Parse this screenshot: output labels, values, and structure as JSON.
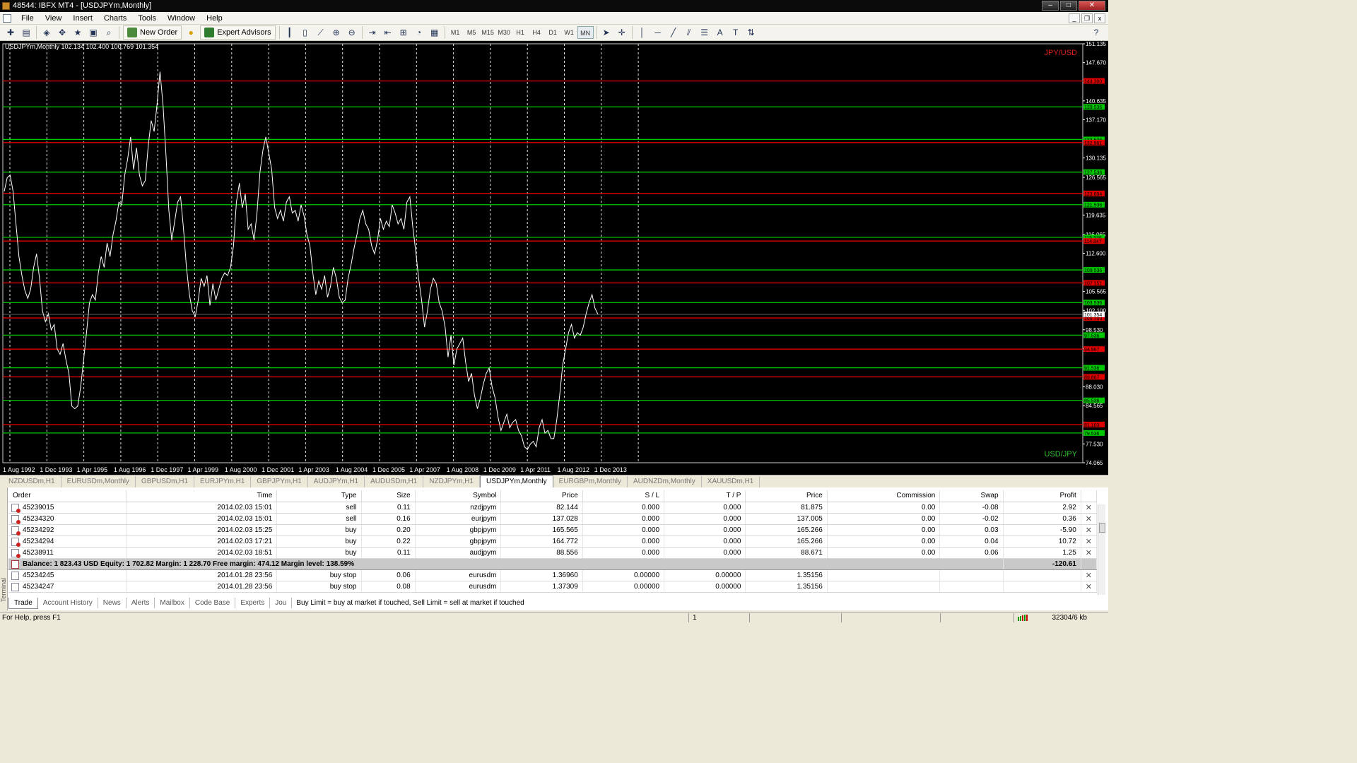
{
  "window": {
    "title": "48544: IBFX MT4 - [USDJPYm,Monthly]"
  },
  "menu": [
    "File",
    "View",
    "Insert",
    "Charts",
    "Tools",
    "Window",
    "Help"
  ],
  "toolbar": {
    "new_order_label": "New Order",
    "expert_advisors_label": "Expert Advisors",
    "timeframes": [
      "M1",
      "M5",
      "M15",
      "M30",
      "H1",
      "H4",
      "D1",
      "W1",
      "MN"
    ],
    "active_timeframe": "MN",
    "icons": [
      "new-chart-icon",
      "profiles-icon",
      "market-watch-icon",
      "navigator-icon",
      "favorites-icon",
      "terminal-icon",
      "tester-icon",
      "bar-chart-icon",
      "candlestick-icon",
      "line-chart-icon",
      "zoom-in-icon",
      "zoom-out-icon",
      "autoscroll-icon",
      "chart-shift-icon",
      "indicators-icon",
      "periods-icon",
      "templates-icon",
      "cursor-icon",
      "crosshair-icon",
      "vertical-line-icon",
      "horizontal-line-icon",
      "trendline-icon",
      "channel-icon",
      "fibonacci-icon",
      "text-icon",
      "label-icon",
      "arrows-icon"
    ]
  },
  "chart": {
    "symbol_info": "USDJPYm,Monthly  102.134 102.400 100.769 101.354",
    "label_top": "JPY/USD",
    "label_bottom": "USD/JPY",
    "current_price_label": "101.354"
  },
  "chart_data": {
    "type": "line",
    "series": [
      {
        "name": "USDJPYm,Monthly",
        "values": [
          124.0,
          126.5,
          127.0,
          124.0,
          118.0,
          112.0,
          108.5,
          105.8,
          104.3,
          106.0,
          110.0,
          112.5,
          108.0,
          102.0,
          100.0,
          101.5,
          98.5,
          99.5,
          95.0,
          94.0,
          96.0,
          93.0,
          90.5,
          84.5,
          84.0,
          84.5,
          88.0,
          93.0,
          98.0,
          103.5,
          105.0,
          104.0,
          109.0,
          112.0,
          110.0,
          114.5,
          112.0,
          116.0,
          118.5,
          122.0,
          121.5,
          127.0,
          130.0,
          134.0,
          128.0,
          132.0,
          127.0,
          125.0,
          126.0,
          132.5,
          137.0,
          135.0,
          140.0,
          146.0,
          140.0,
          131.0,
          120.5,
          115.0,
          118.5,
          122.0,
          123.0,
          117.0,
          110.0,
          105.0,
          102.0,
          101.0,
          104.0,
          108.0,
          106.5,
          108.5,
          103.0,
          107.0,
          104.0,
          106.0,
          108.0,
          109.0,
          108.5,
          110.0,
          114.0,
          122.0,
          125.5,
          121.0,
          123.5,
          117.0,
          118.0,
          115.0,
          120.0,
          127.5,
          131.5,
          134.0,
          131.0,
          128.0,
          121.0,
          119.0,
          120.5,
          118.5,
          122.0,
          123.0,
          120.0,
          120.5,
          118.5,
          121.5,
          119.5,
          116.0,
          114.0,
          109.0,
          105.0,
          107.5,
          106.0,
          108.5,
          104.5,
          106.5,
          110.0,
          108.0,
          104.5,
          103.5,
          104.0,
          108.0,
          110.5,
          113.5,
          116.0,
          119.0,
          120.5,
          118.0,
          117.0,
          114.0,
          112.5,
          115.0,
          119.0,
          117.0,
          118.5,
          117.5,
          121.5,
          120.0,
          118.0,
          119.0,
          117.0,
          122.0,
          123.0,
          117.5,
          113.0,
          108.0,
          104.0,
          99.0,
          102.0,
          106.0,
          108.0,
          107.0,
          103.5,
          102.0,
          99.0,
          93.5,
          97.5,
          92.0,
          95.0,
          96.0,
          97.0,
          92.5,
          89.0,
          90.5,
          86.5,
          84.0,
          86.0,
          88.5,
          90.5,
          91.5,
          88.0,
          86.0,
          82.5,
          80.0,
          81.5,
          83.0,
          80.5,
          81.5,
          82.0,
          80.0,
          79.0,
          77.0,
          76.5,
          77.5,
          78.0,
          77.0,
          80.5,
          82.0,
          79.5,
          80.0,
          78.5,
          78.5,
          82.0,
          86.5,
          92.0,
          95.0,
          98.0,
          99.5,
          97.0,
          98.0,
          97.5,
          99.0,
          101.5,
          103.5,
          105.0,
          102.5,
          101.354
        ]
      }
    ],
    "x_tick_labels": [
      "1 Aug 1992",
      "1 Dec 1993",
      "1 Apr 1995",
      "1 Aug 1996",
      "1 Dec 1997",
      "1 Apr 1999",
      "1 Aug 2000",
      "1 Dec 2001",
      "1 Apr 2003",
      "1 Aug 2004",
      "1 Dec 2005",
      "1 Apr 2007",
      "1 Aug 2008",
      "1 Dec 2009",
      "1 Apr 2011",
      "1 Aug 2012",
      "1 Dec 2013"
    ],
    "y_tick_labels": [
      "151.135",
      "147.670",
      "140.635",
      "137.170",
      "130.135",
      "126.565",
      "119.635",
      "116.065",
      "112.600",
      "105.565",
      "102.100",
      "98.530",
      "95.065",
      "88.030",
      "84.565",
      "77.530",
      "74.065"
    ],
    "ylim": [
      74.065,
      151.135
    ],
    "green_levels": [
      139.536,
      133.536,
      127.536,
      121.536,
      115.536,
      109.536,
      103.536,
      97.536,
      91.536,
      85.536,
      79.536
    ],
    "red_levels": [
      144.3,
      132.961,
      123.604,
      114.847,
      107.151,
      100.703,
      94.967,
      89.867,
      81.103
    ],
    "green_level_labels": [
      "139.536",
      "133.536",
      "127.536",
      "121.536",
      "115.536",
      "109.536",
      "103.536",
      "97.536",
      "91.536",
      "85.536",
      "79.536"
    ],
    "red_level_labels": [
      "144.300",
      "132.961",
      "123.604",
      "114.847",
      "107.151",
      "100.703",
      "94.967",
      "89.867",
      "81.103"
    ],
    "colors": {
      "background": "#000000",
      "price_line": "#ffffff",
      "grid": "#e0e0e0",
      "green_level": "#00c800",
      "red_level": "#e00000"
    }
  },
  "chart_tabs": [
    "NZDUSDm,H1",
    "EURUSDm,Monthly",
    "GBPUSDm,H1",
    "EURJPYm,H1",
    "GBPJPYm,H1",
    "AUDJPYm,H1",
    "AUDUSDm,H1",
    "NZDJPYm,H1",
    "USDJPYm,Monthly",
    "EURGBPm,Monthly",
    "AUDNZDm,Monthly",
    "XAUUSDm,H1"
  ],
  "active_chart_tab": "USDJPYm,Monthly",
  "terminal": {
    "side_label": "Terminal",
    "columns": [
      "Order",
      "Time",
      "Type",
      "Size",
      "Symbol",
      "Price",
      "S / L",
      "T / P",
      "Price",
      "Commission",
      "Swap",
      "Profit"
    ],
    "orders": [
      {
        "order": "45239015",
        "time": "2014.02.03 15:01",
        "type": "sell",
        "size": "0.11",
        "symbol": "nzdjpym",
        "price": "82.144",
        "sl": "0.000",
        "tp": "0.000",
        "cur_price": "81.875",
        "commission": "0.00",
        "swap": "-0.08",
        "profit": "2.92"
      },
      {
        "order": "45234320",
        "time": "2014.02.03 15:01",
        "type": "sell",
        "size": "0.16",
        "symbol": "eurjpym",
        "price": "137.028",
        "sl": "0.000",
        "tp": "0.000",
        "cur_price": "137.005",
        "commission": "0.00",
        "swap": "-0.02",
        "profit": "0.36"
      },
      {
        "order": "45234292",
        "time": "2014.02.03 15:25",
        "type": "buy",
        "size": "0.20",
        "symbol": "gbpjpym",
        "price": "165.565",
        "sl": "0.000",
        "tp": "0.000",
        "cur_price": "165.266",
        "commission": "0.00",
        "swap": "0.03",
        "profit": "-5.90"
      },
      {
        "order": "45234294",
        "time": "2014.02.03 17:21",
        "type": "buy",
        "size": "0.22",
        "symbol": "gbpjpym",
        "price": "164.772",
        "sl": "0.000",
        "tp": "0.000",
        "cur_price": "165.266",
        "commission": "0.00",
        "swap": "0.04",
        "profit": "10.72"
      },
      {
        "order": "45238911",
        "time": "2014.02.03 18:51",
        "type": "buy",
        "size": "0.11",
        "symbol": "audjpym",
        "price": "88.556",
        "sl": "0.000",
        "tp": "0.000",
        "cur_price": "88.671",
        "commission": "0.00",
        "swap": "0.06",
        "profit": "1.25"
      }
    ],
    "balance_text": "Balance: 1 823.43 USD  Equity: 1 702.82  Margin: 1 228.70  Free margin: 474.12  Margin level: 138.59%",
    "balance_profit": "-120.61",
    "pending": [
      {
        "order": "45234245",
        "time": "2014.01.28 23:56",
        "type": "buy stop",
        "size": "0.06",
        "symbol": "eurusdm",
        "price": "1.36960",
        "sl": "0.00000",
        "tp": "0.00000",
        "cur_price": "1.35156"
      },
      {
        "order": "45234247",
        "time": "2014.01.28 23:56",
        "type": "buy stop",
        "size": "0.08",
        "symbol": "eurusdm",
        "price": "1.37309",
        "sl": "0.00000",
        "tp": "0.00000",
        "cur_price": "1.35156"
      }
    ],
    "tabs": [
      "Trade",
      "Account History",
      "News",
      "Alerts",
      "Mailbox",
      "Code Base",
      "Experts",
      "Jou"
    ],
    "active_tab": "Trade",
    "message": "Buy Limit = buy at market if touched, Sell Limit = sell at market if touched"
  },
  "status": {
    "help": "For Help, press F1",
    "page": "1",
    "traffic": "32304/6 kb"
  }
}
